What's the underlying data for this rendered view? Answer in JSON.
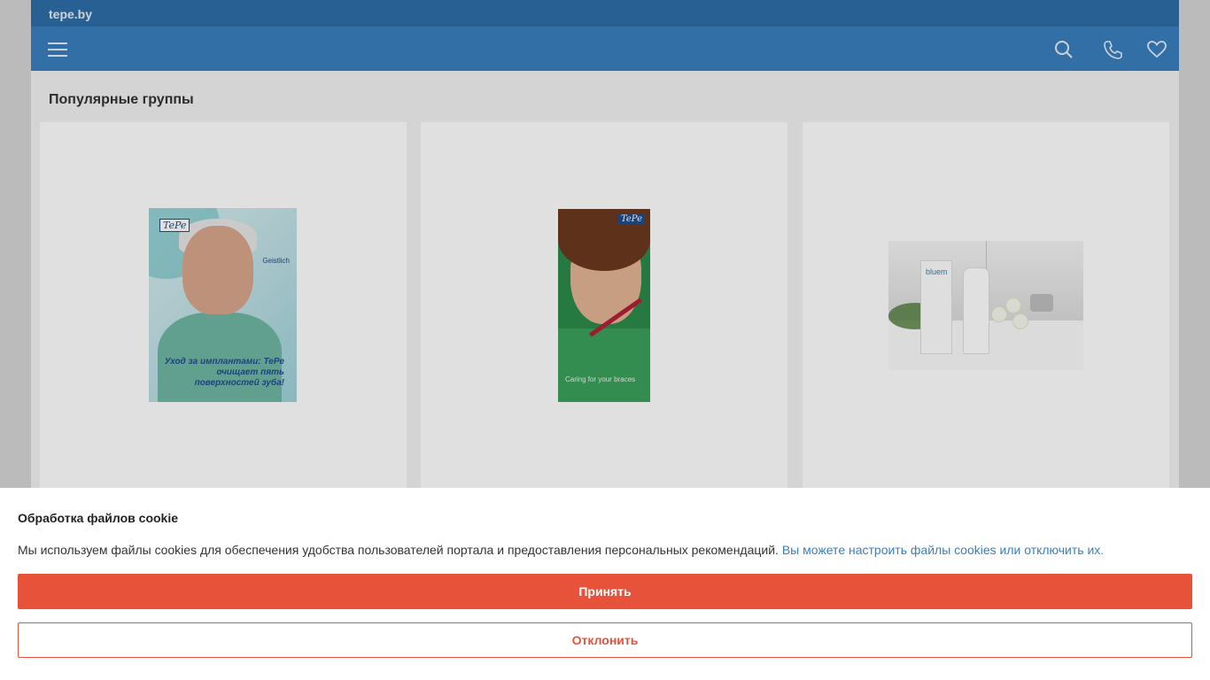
{
  "site": {
    "name": "tepe.by"
  },
  "nav": {
    "icons": [
      "menu-icon",
      "search-icon",
      "phone-icon",
      "heart-icon"
    ]
  },
  "section": {
    "title": "Популярные группы"
  },
  "products": {
    "p1": {
      "logo": "TePe",
      "brand": "Geistlich",
      "caption": "Уход за имплантами: TePe очищает пять поверхностей зуба!"
    },
    "p2": {
      "logo": "TePe",
      "caption": "Caring for your braces"
    },
    "p3": {
      "label": "bluem"
    }
  },
  "cookie": {
    "title": "Обработка файлов cookie",
    "text": "Мы используем файлы cookies для обеспечения удобства пользователей портала и предоставления персональных рекомендаций.",
    "link": "Вы можете настроить файлы cookies или отключить их.",
    "accept": "Принять",
    "decline": "Отклонить"
  },
  "colors": {
    "accent": "#e6523a",
    "header": "#3a7fbf",
    "topbar": "#2f6ea8"
  }
}
